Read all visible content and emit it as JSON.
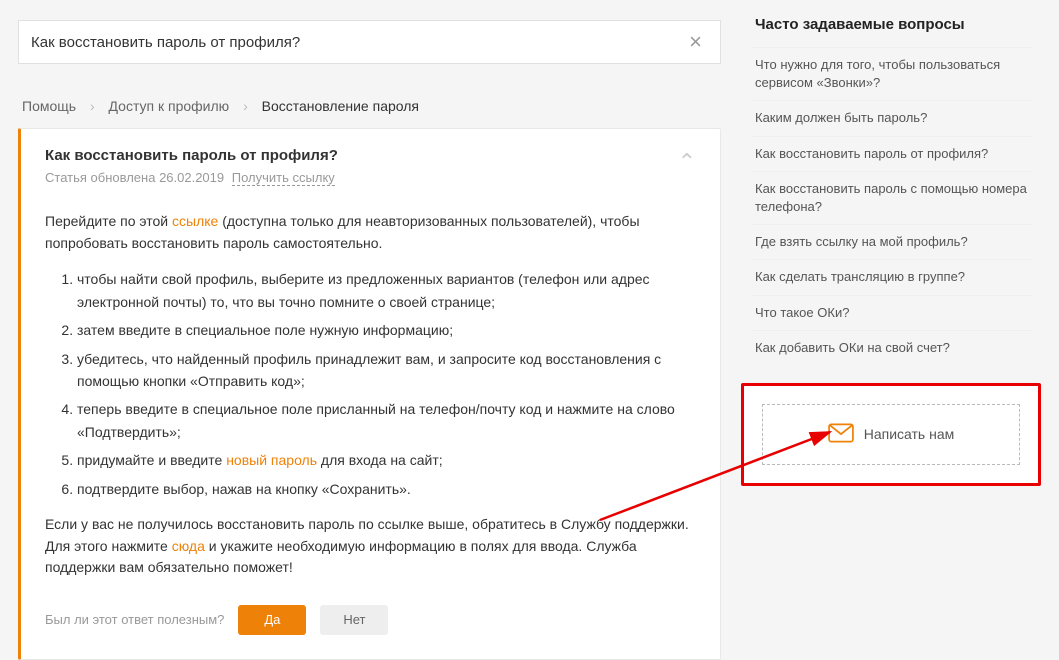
{
  "search": {
    "value": "Как восстановить пароль от профиля?"
  },
  "breadcrumb": {
    "items": [
      "Помощь",
      "Доступ к профилю"
    ],
    "current": "Восстановление пароля"
  },
  "article": {
    "title": "Как восстановить пароль от профиля?",
    "updated_prefix": "Статья обновлена ",
    "updated_date": "26.02.2019",
    "get_link": "Получить ссылку",
    "intro_before": "Перейдите по этой ",
    "intro_link": "ссылке",
    "intro_after": " (доступна только для неавторизованных пользователей), чтобы попробовать восстановить пароль самостоятельно.",
    "steps": [
      "чтобы найти свой профиль, выберите из предложенных вариантов (телефон или адрес электронной почты) то, что вы точно помните о своей странице;",
      "затем введите в специальное поле нужную информацию;",
      "убедитесь, что найденный профиль принадлежит вам, и запросите код восстановления с помощью кнопки «Отправить код»;",
      "теперь введите в специальное поле присланный на телефон/почту код и нажмите на слово «Подтвердить»;",
      "придумайте и введите новый пароль для входа на сайт;",
      "подтвердите выбор, нажав на кнопку «Сохранить»."
    ],
    "step5_before": "придумайте и введите ",
    "step5_link": "новый пароль",
    "step5_after": " для входа на сайт;",
    "outro_before": "Если у вас не получилось восстановить пароль по ссылке выше, обратитесь в Службу поддержки. Для этого нажмите ",
    "outro_link": "сюда",
    "outro_after": " и укажите необходимую информацию в полях для ввода. Служба поддержки вам обязательно поможет!"
  },
  "feedback": {
    "label": "Был ли этот ответ полезным?",
    "yes": "Да",
    "no": "Нет"
  },
  "faq": {
    "title": "Часто задаваемые вопросы",
    "items": [
      "Что нужно для того, чтобы пользоваться сервисом «Звонки»?",
      "Каким должен быть пароль?",
      "Как восстановить пароль от профиля?",
      "Как восстановить пароль с помощью номера телефона?",
      "Где взять ссылку на мой профиль?",
      "Как сделать трансляцию в группе?",
      "Что такое ОКи?",
      "Как добавить ОКи на свой счет?"
    ]
  },
  "contact": {
    "label": "Написать нам"
  }
}
